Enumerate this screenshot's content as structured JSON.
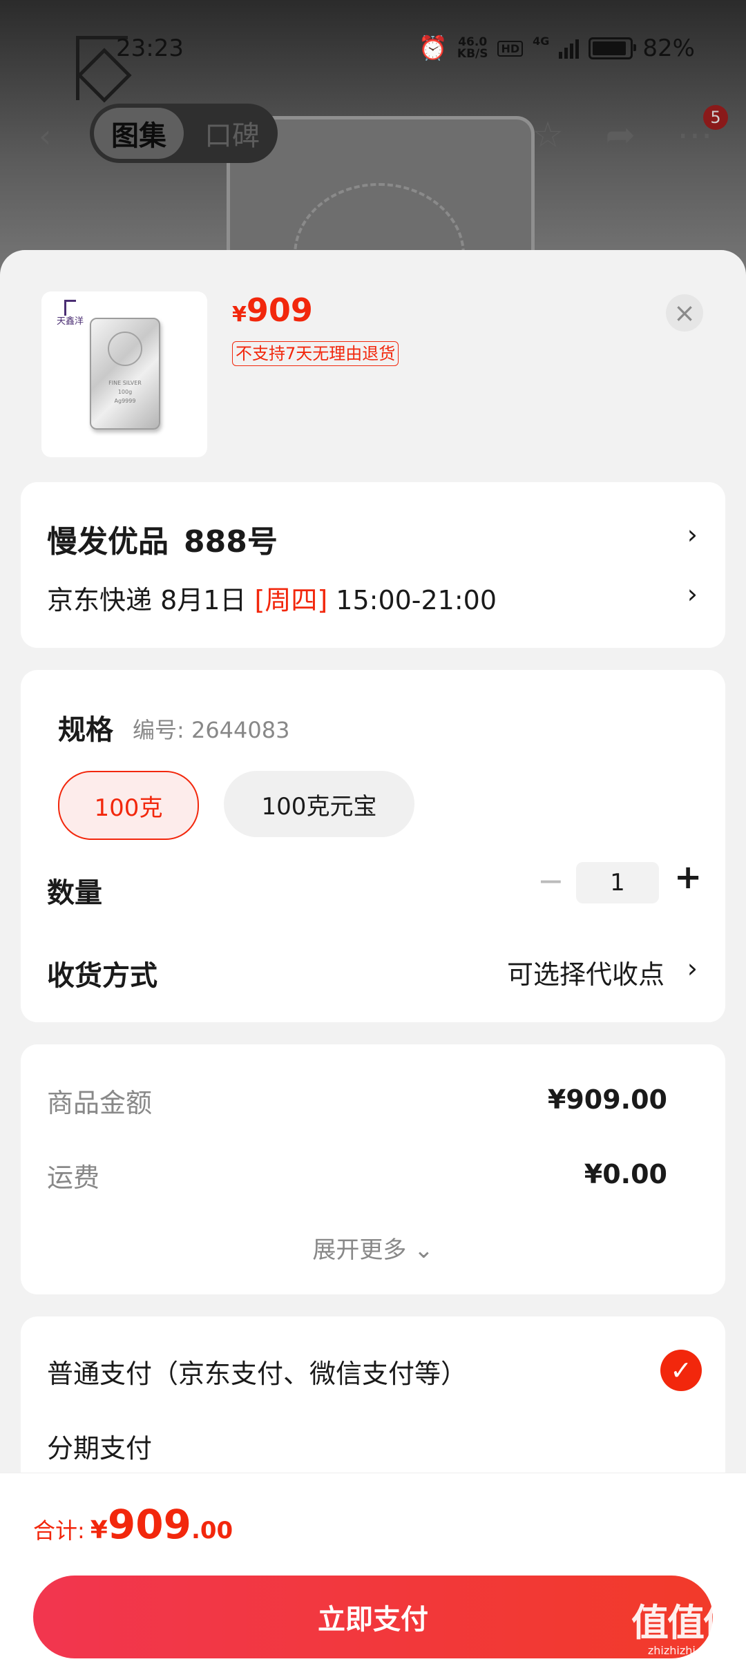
{
  "status_bar": {
    "time": "23:23",
    "net_speed_value": "46.0",
    "net_speed_unit": "KB/S",
    "hd": "HD",
    "network": "4G",
    "battery": "82%"
  },
  "top_nav": {
    "tab_gallery": "图集",
    "tab_reviews": "口碑",
    "cart_badge": "5"
  },
  "product": {
    "price_currency": "¥",
    "price": "909",
    "return_policy": "不支持7天无理由退货",
    "thumb_brand": "天鑫洋",
    "thumb_bar_text_1": "FINE SILVER",
    "thumb_bar_text_2": "100g",
    "thumb_bar_text_3": "Ag9999"
  },
  "address": {
    "name": "慢发优品",
    "number": "888号",
    "delivery_prefix": "京东快递 8月1日",
    "delivery_weekday": "[周四]",
    "delivery_time": "15:00-21:00"
  },
  "spec": {
    "title": "规格",
    "code": "编号: 2644083",
    "options": [
      "100克",
      "100克元宝"
    ],
    "selected_index": 0,
    "quantity_label": "数量",
    "quantity_value": "1",
    "receive_label": "收货方式",
    "receive_value": "可选择代收点"
  },
  "cost": {
    "goods_label": "商品金额",
    "goods_value": "¥909.00",
    "shipping_label": "运费",
    "shipping_value": "¥0.00",
    "expand": "展开更多"
  },
  "payment": {
    "normal": "普通支付（京东支付、微信支付等）",
    "installment": "分期支付"
  },
  "footer": {
    "total_label": "合计:",
    "total_currency": "¥",
    "total_int": "909",
    "total_dec": ".00",
    "pay_button": "立即支付"
  },
  "watermark": {
    "main": "值值值",
    "sub": "zhizhizhi.com"
  },
  "colors": {
    "accent": "#f2270c",
    "sheet_bg": "#f2f2f2",
    "card_bg": "#ffffff"
  }
}
